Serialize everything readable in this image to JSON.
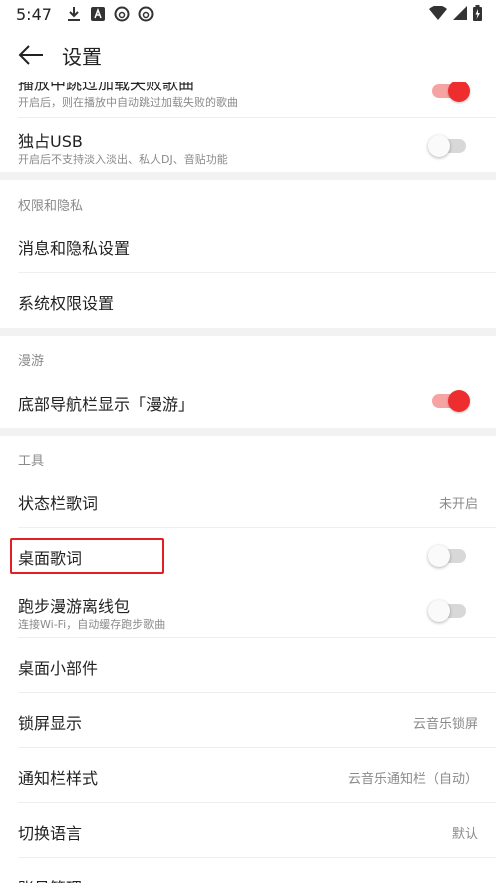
{
  "status_bar": {
    "time": "5:47"
  },
  "app_bar": {
    "title": "设置"
  },
  "rows": {
    "skip_failed": {
      "title": "播放中跳过加载失败歌曲",
      "subtitle": "开启后，则在播放中自动跳过加载失败的歌曲",
      "toggle": "on"
    },
    "exclusive_usb": {
      "title": "独占USB",
      "subtitle": "开启后不支持淡入淡出、私人DJ、音贴功能",
      "toggle": "off"
    },
    "permissions_header": "权限和隐私",
    "message_privacy": {
      "title": "消息和隐私设置"
    },
    "system_permissions": {
      "title": "系统权限设置"
    },
    "roam_header": "漫游",
    "bottom_nav_roam": {
      "title": "底部导航栏显示「漫游」",
      "toggle": "on"
    },
    "tools_header": "工具",
    "status_lyrics": {
      "title": "状态栏歌词",
      "value": "未开启"
    },
    "desktop_lyrics": {
      "title": "桌面歌词",
      "toggle": "off"
    },
    "run_roam_offline": {
      "title": "跑步漫游离线包",
      "subtitle": "连接Wi-Fi，自动缓存跑步歌曲",
      "toggle": "off"
    },
    "desktop_widget": {
      "title": "桌面小部件"
    },
    "lockscreen": {
      "title": "锁屏显示",
      "value": "云音乐锁屏"
    },
    "notification_style": {
      "title": "通知栏样式",
      "value": "云音乐通知栏（自动）"
    },
    "language": {
      "title": "切换语言",
      "value": "默认"
    },
    "account_management": {
      "title": "账号管理"
    }
  },
  "colors": {
    "accent": "#ee2e2e",
    "highlight": "#e02020"
  }
}
